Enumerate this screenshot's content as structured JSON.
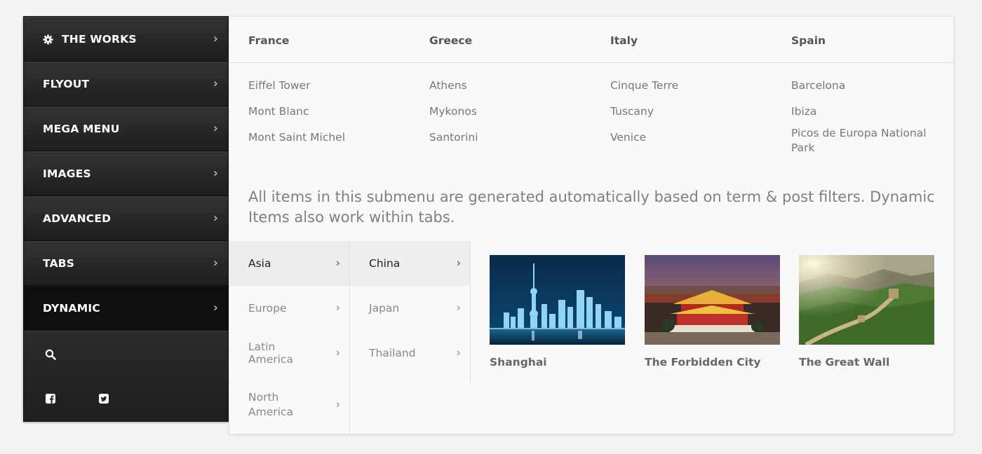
{
  "sidebar": {
    "items": [
      {
        "label": "THE WORKS",
        "icon": "gear-icon"
      },
      {
        "label": "FLYOUT"
      },
      {
        "label": "MEGA MENU"
      },
      {
        "label": "IMAGES"
      },
      {
        "label": "ADVANCED"
      },
      {
        "label": "TABS"
      },
      {
        "label": "DYNAMIC",
        "active": true
      }
    ],
    "arrow_glyph": "›",
    "bottom_icons": [
      "search-icon",
      "facebook-icon",
      "twitter-icon"
    ]
  },
  "panel": {
    "columns": [
      {
        "header": "France",
        "links": [
          "Eiffel Tower",
          "Mont Blanc",
          "Mont Saint Michel"
        ]
      },
      {
        "header": "Greece",
        "links": [
          "Athens",
          "Mykonos",
          "Santorini"
        ]
      },
      {
        "header": "Italy",
        "links": [
          "Cinque Terre",
          "Tuscany",
          "Venice"
        ]
      },
      {
        "header": "Spain",
        "links": [
          "Barcelona",
          "Ibiza",
          "Picos de Europa National Park"
        ]
      }
    ],
    "description": "All items in this submenu are generated automatically based on term & post filters. Dynamic Items also work within tabs.",
    "region_tabs": [
      "Asia",
      "Europe",
      "Latin America",
      "North America"
    ],
    "country_tabs": [
      "China",
      "Japan",
      "Thailand"
    ],
    "cards": [
      {
        "caption": "Shanghai"
      },
      {
        "caption": "The Forbidden City"
      },
      {
        "caption": "The Great Wall"
      }
    ]
  },
  "colors": {
    "sidebar_bg": "#2a2a2a",
    "sidebar_active": "#0f0f0f",
    "panel_bg": "#f9f9f9",
    "text_muted": "#777777"
  }
}
